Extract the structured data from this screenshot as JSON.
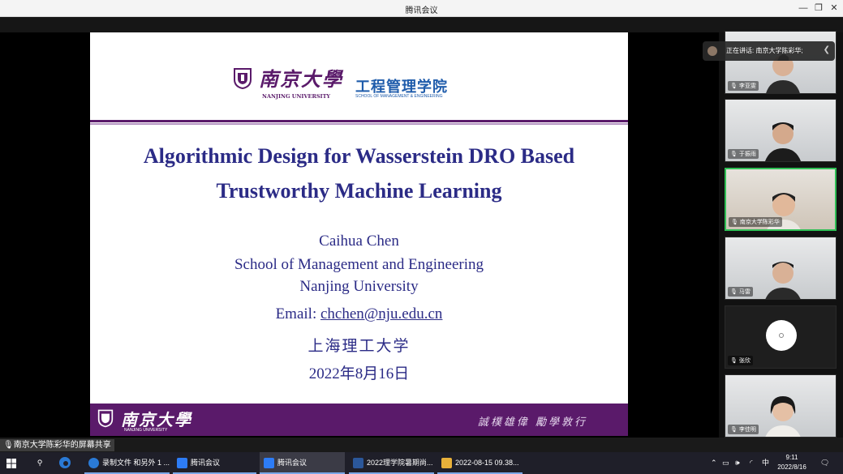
{
  "window": {
    "title": "腾讯会议",
    "minimize": "—",
    "restore": "❐",
    "close": "✕"
  },
  "slide": {
    "header": {
      "university_cn": "南京大學",
      "university_en": "NANJING UNIVERSITY",
      "school_cn": "工程管理学院",
      "school_en": "SCHOOL OF MANAGEMENT & ENGINEERING"
    },
    "title_line1": "Algorithmic Design for Wasserstein DRO Based",
    "title_line2": "Trustworthy Machine Learning",
    "author": "Caihua Chen",
    "school": "School of Management and Engineering",
    "university": "Nanjing University",
    "email_label": "Email: ",
    "email": "chchen@nju.edu.cn",
    "venue": "上海理工大学",
    "date": "2022年8月16日",
    "footer": {
      "university_cn": "南京大學",
      "university_en": "NANJING UNIVERSITY",
      "motto": "誠樸雄偉 勵學敦行"
    },
    "colors": {
      "purple": "#5a1a6a",
      "title_blue": "#2b2b86",
      "school_blue": "#1f5cab"
    }
  },
  "speaking": {
    "text": "正在讲话: 南京大学陈彩华;"
  },
  "participants": [
    {
      "name": "李亚雯",
      "icon": "mic-icon"
    },
    {
      "name": "于振雨",
      "icon": "mic-icon"
    },
    {
      "name": "南京大学陈彩华",
      "icon": "mic-icon"
    },
    {
      "name": "马雷",
      "icon": "mic-icon"
    },
    {
      "name": "张欣",
      "icon": "mic-icon"
    },
    {
      "name": "李佳明",
      "icon": "mic-icon"
    }
  ],
  "share_label": "南京大学陈彩华的屏幕共享",
  "taskbar": {
    "tasks": [
      {
        "label": "录制文件 和另外 1 ...",
        "color": "#2a7ad6"
      },
      {
        "label": "腾讯会议",
        "color": "#2d7cf6"
      },
      {
        "label": "腾讯会议",
        "color": "#2d7cf6"
      },
      {
        "label": "2022理学院暑期尚...",
        "color": "#2b579a"
      },
      {
        "label": "2022-08-15 09.38...",
        "color": "#e8b13a"
      }
    ],
    "tray_ime": "中",
    "time": "9:11",
    "date": "2022/8/16"
  }
}
